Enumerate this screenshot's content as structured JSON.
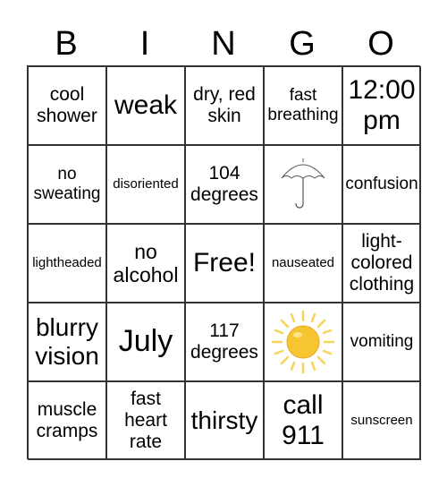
{
  "header": [
    "B",
    "I",
    "N",
    "G",
    "O"
  ],
  "cells": [
    "cool shower",
    "weak",
    "dry, red skin",
    "fast breathing",
    "12:00 pm",
    "no sweating",
    "disoriented",
    "104 degrees",
    "",
    "confusion",
    "lightheaded",
    "no alcohol",
    "Free!",
    "nauseated",
    "light-colored clothing",
    "blurry vision",
    "July",
    "117 degrees",
    "",
    "vomiting",
    "muscle cramps",
    "fast heart rate",
    "thirsty",
    "call 911",
    "sunscreen"
  ],
  "images": {
    "umbrella": "umbrella-icon",
    "sun": "sun-icon"
  },
  "colors": {
    "sun": "#f7c531",
    "grid": "#333333"
  }
}
